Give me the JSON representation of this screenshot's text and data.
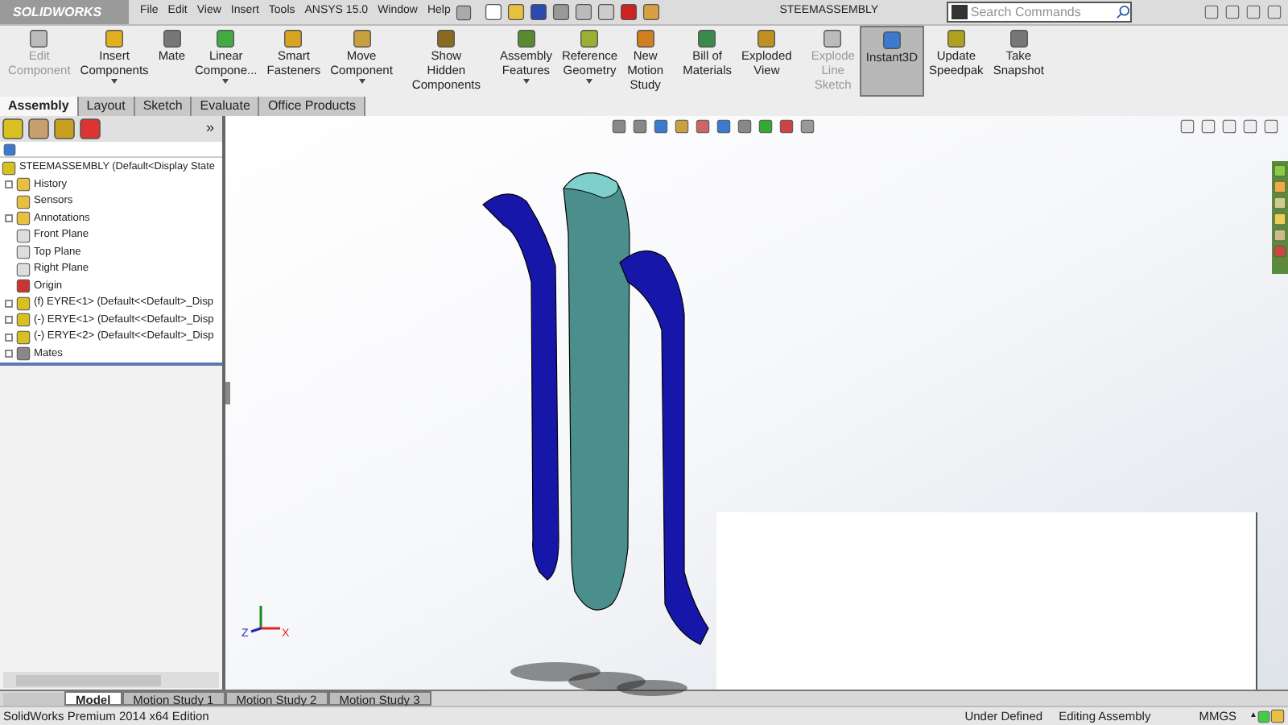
{
  "app": {
    "logo": "SOLIDWORKS",
    "title": "STEEMASSEMBLY"
  },
  "menu": [
    "File",
    "Edit",
    "View",
    "Insert",
    "Tools",
    "ANSYS 15.0",
    "Window",
    "Help"
  ],
  "search": {
    "placeholder": "Search Commands"
  },
  "toolbar": [
    {
      "label": "Edit\nComponent",
      "disabled": true,
      "selected": false,
      "dropdown": false
    },
    {
      "label": "Insert\nComponents",
      "disabled": false,
      "selected": false,
      "dropdown": true
    },
    {
      "label": "Mate",
      "disabled": false,
      "selected": false,
      "dropdown": false
    },
    {
      "label": "Linear\nCompone...",
      "disabled": false,
      "selected": false,
      "dropdown": true
    },
    {
      "label": "Smart\nFasteners",
      "disabled": false,
      "selected": false,
      "dropdown": false
    },
    {
      "label": "Move\nComponent",
      "disabled": false,
      "selected": false,
      "dropdown": true
    },
    {
      "label": "Show\nHidden\nComponents",
      "disabled": false,
      "selected": false,
      "dropdown": false
    },
    {
      "label": "Assembly\nFeatures",
      "disabled": false,
      "selected": false,
      "dropdown": true
    },
    {
      "label": "Reference\nGeometry",
      "disabled": false,
      "selected": false,
      "dropdown": true
    },
    {
      "label": "New\nMotion\nStudy",
      "disabled": false,
      "selected": false,
      "dropdown": false
    },
    {
      "label": "Bill of\nMaterials",
      "disabled": false,
      "selected": false,
      "dropdown": false
    },
    {
      "label": "Exploded\nView",
      "disabled": false,
      "selected": false,
      "dropdown": false
    },
    {
      "label": "Explode\nLine\nSketch",
      "disabled": true,
      "selected": false,
      "dropdown": false
    },
    {
      "label": "Instant3D",
      "disabled": false,
      "selected": true,
      "dropdown": false
    },
    {
      "label": "Update\nSpeedpak",
      "disabled": false,
      "selected": false,
      "dropdown": false
    },
    {
      "label": "Take\nSnapshot",
      "disabled": false,
      "selected": false,
      "dropdown": false
    }
  ],
  "command_tabs": [
    {
      "label": "Assembly",
      "selected": true
    },
    {
      "label": "Layout",
      "selected": false
    },
    {
      "label": "Sketch",
      "selected": false
    },
    {
      "label": "Evaluate",
      "selected": false
    },
    {
      "label": "Office Products",
      "selected": false
    }
  ],
  "tree": {
    "label": "STEEMASSEMBLY  (Default<Display State",
    "children": [
      {
        "label": "History",
        "expandable": true
      },
      {
        "label": "Sensors",
        "expandable": false
      },
      {
        "label": "Annotations",
        "expandable": true
      },
      {
        "label": "Front Plane",
        "expandable": false
      },
      {
        "label": "Top Plane",
        "expandable": false
      },
      {
        "label": "Right Plane",
        "expandable": false
      },
      {
        "label": "Origin",
        "expandable": false
      },
      {
        "label": "(f) EYRE<1> (Default<<Default>_Disp",
        "expandable": true
      },
      {
        "label": "(-) ERYE<1> (Default<<Default>_Disp",
        "expandable": true
      },
      {
        "label": "(-) ERYE<2> (Default<<Default>_Disp",
        "expandable": true
      },
      {
        "label": "Mates",
        "expandable": true
      }
    ]
  },
  "panel_expand": "»",
  "triad": {
    "x": "X",
    "z": "Z"
  },
  "bottom_tabs": [
    {
      "label": "Model",
      "selected": true
    },
    {
      "label": "Motion Study 1",
      "selected": false
    },
    {
      "label": "Motion Study 2",
      "selected": false
    },
    {
      "label": "Motion Study 3",
      "selected": false
    }
  ],
  "status_bar": {
    "edition": "SolidWorks Premium 2014 x64 Edition",
    "state": "Under Defined",
    "mode": "Editing Assembly",
    "units": "MMGS",
    "units_arrow": "▲"
  }
}
